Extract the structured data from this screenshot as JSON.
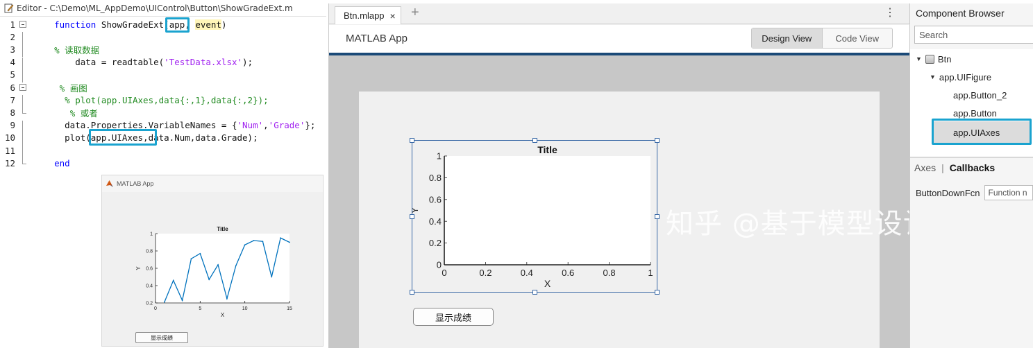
{
  "editor": {
    "title": "Editor - C:\\Demo\\ML_AppDemo\\UIControl\\Button\\ShowGradeExt.m",
    "lines": [
      {
        "n": "1",
        "segments": [
          {
            "t": "    ",
            "c": ""
          },
          {
            "t": "function",
            "c": "kw"
          },
          {
            "t": " ShowGradeExt(",
            "c": ""
          },
          {
            "t": "app",
            "c": ""
          },
          {
            "t": ", ",
            "c": ""
          },
          {
            "t": "event",
            "c": "hl"
          },
          {
            "t": ")",
            "c": ""
          }
        ]
      },
      {
        "n": "2",
        "segments": []
      },
      {
        "n": "3",
        "segments": [
          {
            "t": "    ",
            "c": ""
          },
          {
            "t": "% 读取数据",
            "c": "cm"
          }
        ]
      },
      {
        "n": "4",
        "segments": [
          {
            "t": "        data = readtable(",
            "c": ""
          },
          {
            "t": "'TestData.xlsx'",
            "c": "st"
          },
          {
            "t": ");",
            "c": ""
          }
        ]
      },
      {
        "n": "5",
        "segments": []
      },
      {
        "n": "6",
        "segments": [
          {
            "t": "     ",
            "c": ""
          },
          {
            "t": "% 画图",
            "c": "cm"
          }
        ]
      },
      {
        "n": "7",
        "segments": [
          {
            "t": "      ",
            "c": ""
          },
          {
            "t": "% plot(app.UIAxes,data{:,1},data{:,2});",
            "c": "cm"
          }
        ]
      },
      {
        "n": "8",
        "segments": [
          {
            "t": "       ",
            "c": ""
          },
          {
            "t": "% 或者",
            "c": "cm"
          }
        ]
      },
      {
        "n": "9",
        "segments": [
          {
            "t": "      data.Properties.VariableNames = {",
            "c": ""
          },
          {
            "t": "'Num'",
            "c": "st"
          },
          {
            "t": ",",
            "c": ""
          },
          {
            "t": "'Grade'",
            "c": "st"
          },
          {
            "t": "};",
            "c": ""
          }
        ]
      },
      {
        "n": "10",
        "segments": [
          {
            "t": "      plot(app.UIAxes,data.Num,data.Grade);",
            "c": ""
          }
        ]
      },
      {
        "n": "11",
        "segments": []
      },
      {
        "n": "12",
        "segments": [
          {
            "t": "    ",
            "c": ""
          },
          {
            "t": "end",
            "c": "kw"
          }
        ]
      }
    ]
  },
  "runtime_app": {
    "window_title": "MATLAB App",
    "button_label": "显示成绩"
  },
  "designer": {
    "tab_label": "Btn.mlapp",
    "tab_close": "×",
    "tab_add": "+",
    "more": "⋮",
    "app_title": "MATLAB App",
    "design_view": "Design View",
    "code_view": "Code View",
    "button_label": "显示成绩"
  },
  "watermark": "知乎 @基于模型设计柚子",
  "component_browser": {
    "title": "Component Browser",
    "search_placeholder": "Search",
    "tree": [
      {
        "label": "Btn",
        "level": 0
      },
      {
        "label": "app.UIFigure",
        "level": 1
      },
      {
        "label": "app.Button_2",
        "level": 2
      },
      {
        "label": "app.Button",
        "level": 2
      },
      {
        "label": "app.UIAxes",
        "level": 2,
        "selected": true
      }
    ],
    "tabs": {
      "axes": "Axes",
      "callbacks": "Callbacks"
    },
    "property_label": "ButtonDownFcn",
    "property_value": "Function n"
  },
  "chart_data": [
    {
      "type": "line",
      "title": "Title",
      "xlabel": "X",
      "ylabel": "Y",
      "xlim": [
        0,
        15
      ],
      "ylim": [
        0.2,
        1
      ],
      "xticks": [
        "0",
        "5",
        "10",
        "15"
      ],
      "yticks": [
        "0.2",
        "0.4",
        "0.6",
        "0.8",
        "1"
      ],
      "series": [
        {
          "x": [
            1,
            2,
            3,
            4,
            5,
            6,
            7,
            8,
            9,
            10,
            11,
            12,
            13,
            14,
            15
          ],
          "values": [
            0.21,
            0.46,
            0.23,
            0.71,
            0.77,
            0.47,
            0.64,
            0.25,
            0.63,
            0.87,
            0.92,
            0.91,
            0.5,
            0.95,
            0.9
          ],
          "color": "#0072bd"
        }
      ]
    },
    {
      "type": "line",
      "title": "Title",
      "xlabel": "X",
      "ylabel": "Y",
      "xlim": [
        0,
        1
      ],
      "ylim": [
        0,
        1
      ],
      "xticks": [
        "0",
        "0.2",
        "0.4",
        "0.6",
        "0.8",
        "1"
      ],
      "yticks": [
        "0",
        "0.2",
        "0.4",
        "0.6",
        "0.8",
        "1"
      ],
      "series": []
    }
  ]
}
